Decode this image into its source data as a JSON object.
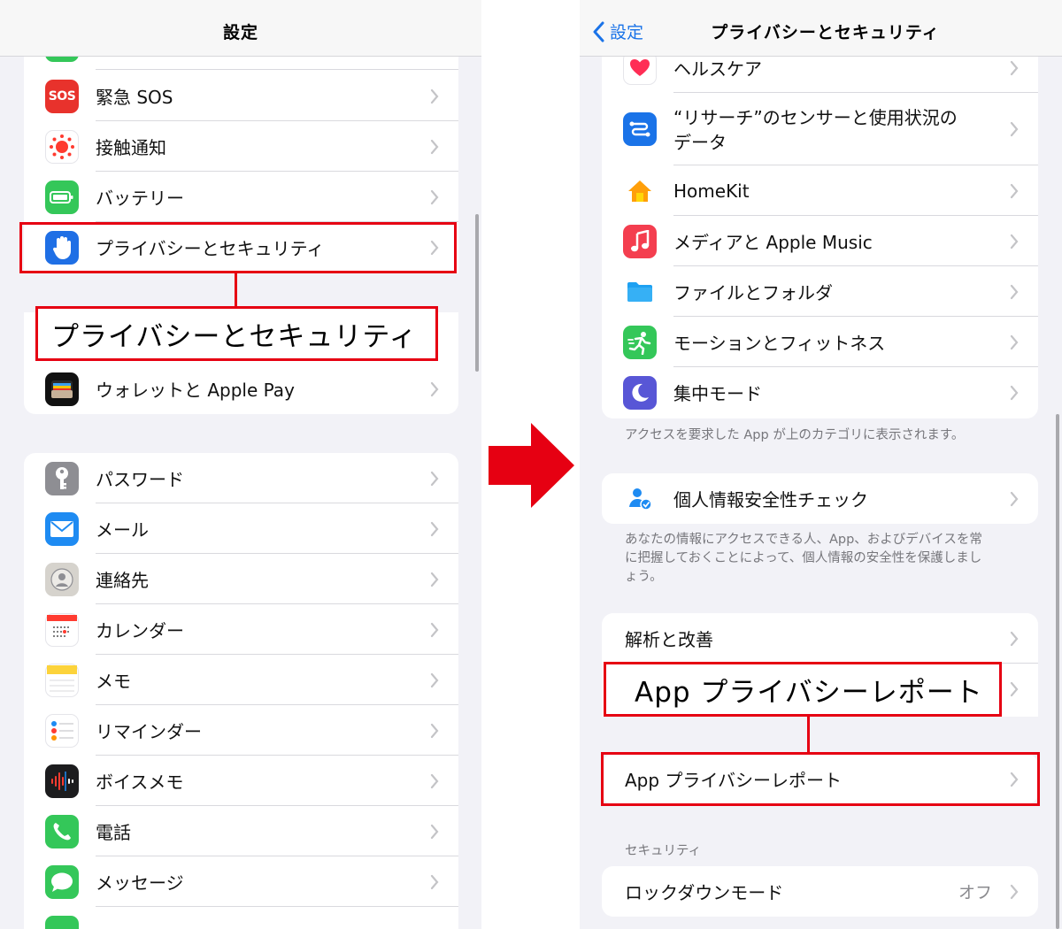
{
  "left": {
    "title": "設定",
    "group1": [
      {
        "label": "緊急 SOS",
        "icon": "sos-icon",
        "icon_text": "SOS",
        "color": "#e8322c"
      },
      {
        "label": "接触通知",
        "icon": "exposure-notification-icon",
        "color": "#ffffff"
      },
      {
        "label": "バッテリー",
        "icon": "battery-icon",
        "color": "#34c759"
      },
      {
        "label": "プライバシーとセキュリティ",
        "icon": "hand-icon",
        "color": "#1f6fe5"
      }
    ],
    "callout": "プライバシーとセキュリティ",
    "wallet": {
      "label": "ウォレットと Apple Pay",
      "icon": "wallet-icon",
      "color": "#111111"
    },
    "group2": [
      {
        "label": "パスワード",
        "icon": "key-icon",
        "color": "#8e8e93"
      },
      {
        "label": "メール",
        "icon": "mail-icon",
        "color": "#1e8bf2"
      },
      {
        "label": "連絡先",
        "icon": "contacts-icon",
        "color": "#c7c4be"
      },
      {
        "label": "カレンダー",
        "icon": "calendar-icon",
        "color": "#ffffff"
      },
      {
        "label": "メモ",
        "icon": "notes-icon",
        "color": "#ffffff"
      },
      {
        "label": "リマインダー",
        "icon": "reminders-icon",
        "color": "#ffffff"
      },
      {
        "label": "ボイスメモ",
        "icon": "voice-memo-icon",
        "color": "#1c1c1e"
      },
      {
        "label": "電話",
        "icon": "phone-icon",
        "color": "#34c759"
      },
      {
        "label": "メッセージ",
        "icon": "messages-icon",
        "color": "#34c759"
      }
    ]
  },
  "right": {
    "back_label": "設定",
    "title": "プライバシーとセキュリティ",
    "group1": [
      {
        "label": "ヘルスケア",
        "icon": "health-icon",
        "color": "#ffffff"
      },
      {
        "label": "“リサーチ”のセンサーと使用状況の",
        "label2": "データ",
        "icon": "research-icon",
        "color": "#1a73e8"
      },
      {
        "label": "HomeKit",
        "icon": "home-icon",
        "color": "#ffffff"
      },
      {
        "label": "メディアと Apple Music",
        "icon": "music-icon",
        "color": "#f43e4f"
      },
      {
        "label": "ファイルとフォルダ",
        "icon": "folder-icon",
        "color": "#ffffff"
      },
      {
        "label": "モーションとフィットネス",
        "icon": "fitness-icon",
        "color": "#34c759"
      },
      {
        "label": "集中モード",
        "icon": "focus-icon",
        "color": "#5856d6"
      }
    ],
    "footnote1": "アクセスを要求した App が上のカテゴリに表示されます。",
    "safety_check": {
      "label": "個人情報安全性チェック",
      "icon": "person-shield-icon"
    },
    "footnote2_lines": [
      "あなたの情報にアクセスできる人、App、およびデバイスを常",
      "に把握しておくことによって、個人情報の安全性を保護しまし",
      "ょう。"
    ],
    "analytics": "解析と改善",
    "callout": "App プライバシーレポート",
    "report": "App プライバシーレポート",
    "security_header": "セキュリティ",
    "lockdown": {
      "label": "ロックダウンモード",
      "value": "オフ"
    }
  },
  "colors": {
    "highlight": "#e60012",
    "link": "#1a73e8"
  }
}
